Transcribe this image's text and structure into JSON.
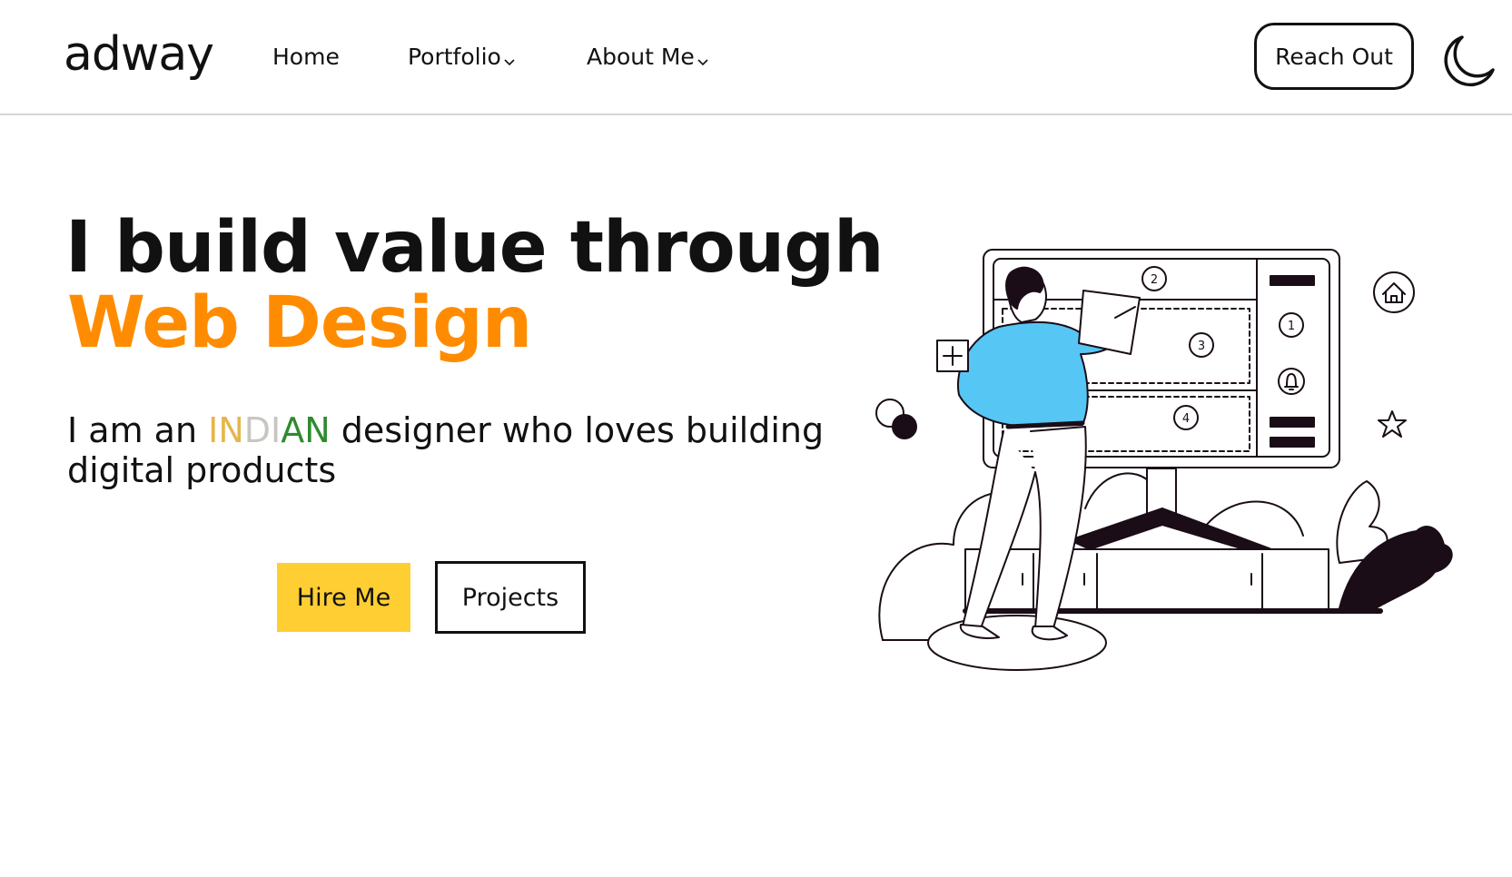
{
  "brand": {
    "logo_text": "adway"
  },
  "nav": {
    "home": "Home",
    "portfolio": "Portfolio",
    "about": "About Me"
  },
  "header": {
    "cta_label": "Reach Out",
    "theme_icon": "moon-icon"
  },
  "hero": {
    "title_line1": "I build value through",
    "title_line2": "Web Design",
    "tagline_prefix": "I am an ",
    "tagline_highlight_parts": [
      "IN",
      "DI",
      "AN"
    ],
    "tagline_suffix": " designer who loves building digital products",
    "primary_button": "Hire Me",
    "secondary_button": "Projects"
  },
  "illustration": {
    "board_labels": [
      "1",
      "2",
      "3",
      "4"
    ],
    "icons": [
      "home-icon",
      "star-icon",
      "plus-icon",
      "bell-icon",
      "leaf-icon"
    ]
  },
  "colors": {
    "accent_orange": "#ff8c00",
    "button_yellow": "#ffce33",
    "saffron": "#e7b54a",
    "white_mid": "#c9c6c1",
    "green": "#2e8b2e",
    "person_shirt": "#56c6f5",
    "ink": "#1a0d17"
  }
}
